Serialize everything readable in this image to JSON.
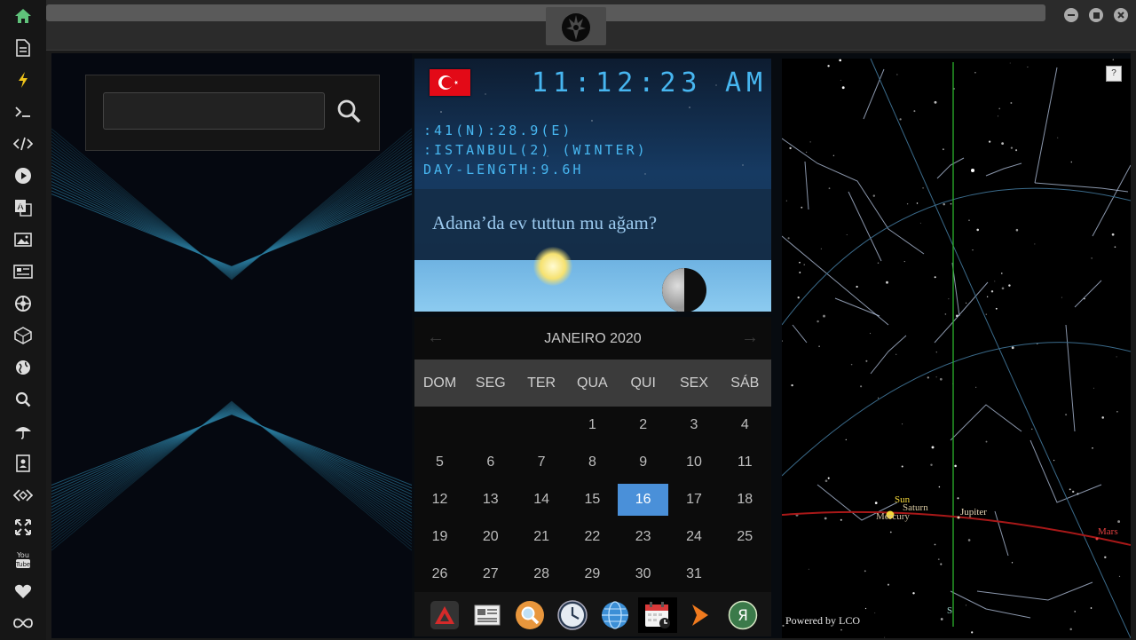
{
  "window": {
    "logo_icon": "rebel-alliance-icon",
    "buttons": [
      "minimize-icon",
      "maximize-icon",
      "close-icon"
    ]
  },
  "sidebar": {
    "icons": [
      "home-icon",
      "document-icon",
      "bolt-icon",
      "terminal-icon",
      "code-icon",
      "play-icon",
      "translate-icon",
      "image-icon",
      "news-icon",
      "settings-wheel-icon",
      "cube-icon",
      "globe-icon",
      "search-icon",
      "umbrella-icon",
      "contacts-icon",
      "link-icon",
      "expand-icon",
      "youtube-icon",
      "heart-icon",
      "infinity-icon"
    ],
    "accent_active": "#5fc27a",
    "accent_bolt": "#f0c419"
  },
  "search": {
    "value": "",
    "placeholder": ""
  },
  "clock": {
    "time": "11:12:23",
    "ampm": "AM",
    "coords": ":41(N):28.9(E)",
    "location": ":ISTANBUL(2) (WINTER)",
    "day_length": "DAY-LENGTH:9.6H",
    "quote": "Adana’da ev tuttun mu ağam?",
    "lcd_color": "#47b6f0",
    "flag": "turkey-flag"
  },
  "calendar": {
    "title": "JANEIRO 2020",
    "weekdays": [
      "DOM",
      "SEG",
      "TER",
      "QUA",
      "QUI",
      "SEX",
      "SÁB"
    ],
    "first_weekday_index": 3,
    "days_in_month": 31,
    "selected_day": 16,
    "prev_label": "←",
    "next_label": "→"
  },
  "dock": {
    "items": [
      "triangle-app-icon",
      "news-reader-icon",
      "search-app-icon",
      "clock-app-icon",
      "globe-app-icon",
      "calendar-app-icon",
      "arrow-app-icon",
      "yandex-icon"
    ],
    "active_index": 5
  },
  "sky": {
    "help_label": "?",
    "powered_by": "Powered by LCO",
    "south_label": "S",
    "planets": [
      {
        "name": "Sun",
        "color": "#f5d83a"
      },
      {
        "name": "Saturn",
        "color": "#d6c7a0"
      },
      {
        "name": "Mercury",
        "color": "#cfbfa3"
      },
      {
        "name": "Jupiter",
        "color": "#e8d7b7"
      },
      {
        "name": "Mars",
        "color": "#e34040"
      }
    ]
  }
}
